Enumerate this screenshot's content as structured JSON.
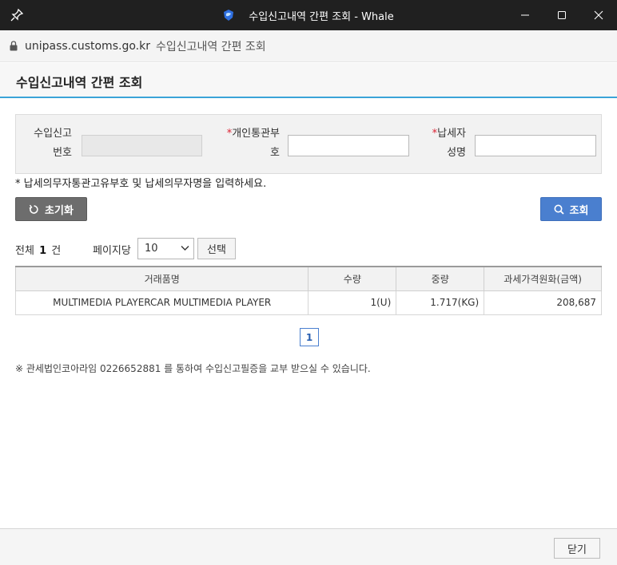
{
  "window": {
    "title": "수입신고내역 간편 조회 - Whale"
  },
  "address": {
    "host": "unipass.customs.go.kr",
    "page_title": "수입신고내역 간편 조회"
  },
  "header": {
    "title": "수입신고내역 간편 조회"
  },
  "form": {
    "import_no_label_1": "수입신고",
    "import_no_label_2": "번호",
    "customs_code_label_1": "개인통관부",
    "customs_code_label_2": "호",
    "taxpayer_label_1": "납세자",
    "taxpayer_label_2": "성명",
    "required_mark": "*",
    "import_no_value": "",
    "customs_code_value": "",
    "taxpayer_value": ""
  },
  "notice": "* 납세의무자통관고유부호 및 납세의무자명을 입력하세요.",
  "buttons": {
    "reset": "초기화",
    "search": "조회",
    "select": "선택",
    "close": "닫기"
  },
  "results": {
    "total_prefix": "전체",
    "total_count": "1",
    "total_suffix": "건",
    "per_page_label": "페이지당",
    "per_page_value": "10"
  },
  "table": {
    "columns": [
      "거래품명",
      "수량",
      "중량",
      "과세가격원화(금액)"
    ],
    "rows": [
      [
        "MULTIMEDIA PLAYERCAR MULTIMEDIA PLAYER",
        "1(U)",
        "1.717(KG)",
        "208,687"
      ]
    ]
  },
  "pagination": {
    "current": "1"
  },
  "footnote": "※ 관세법인코아라임 0226652881 를 통하여 수입신고필증을 교부 받으실 수 있습니다.",
  "colors": {
    "titlebar": "#202020",
    "accent_line": "#3aa3d8",
    "search_button": "#4a7fcf",
    "reset_button": "#6d6d6d",
    "required": "#dd2233"
  },
  "icons": {
    "pin": "pin-icon",
    "app": "whale-icon",
    "lock": "lock-icon",
    "reset": "refresh-icon",
    "search": "search-icon"
  }
}
